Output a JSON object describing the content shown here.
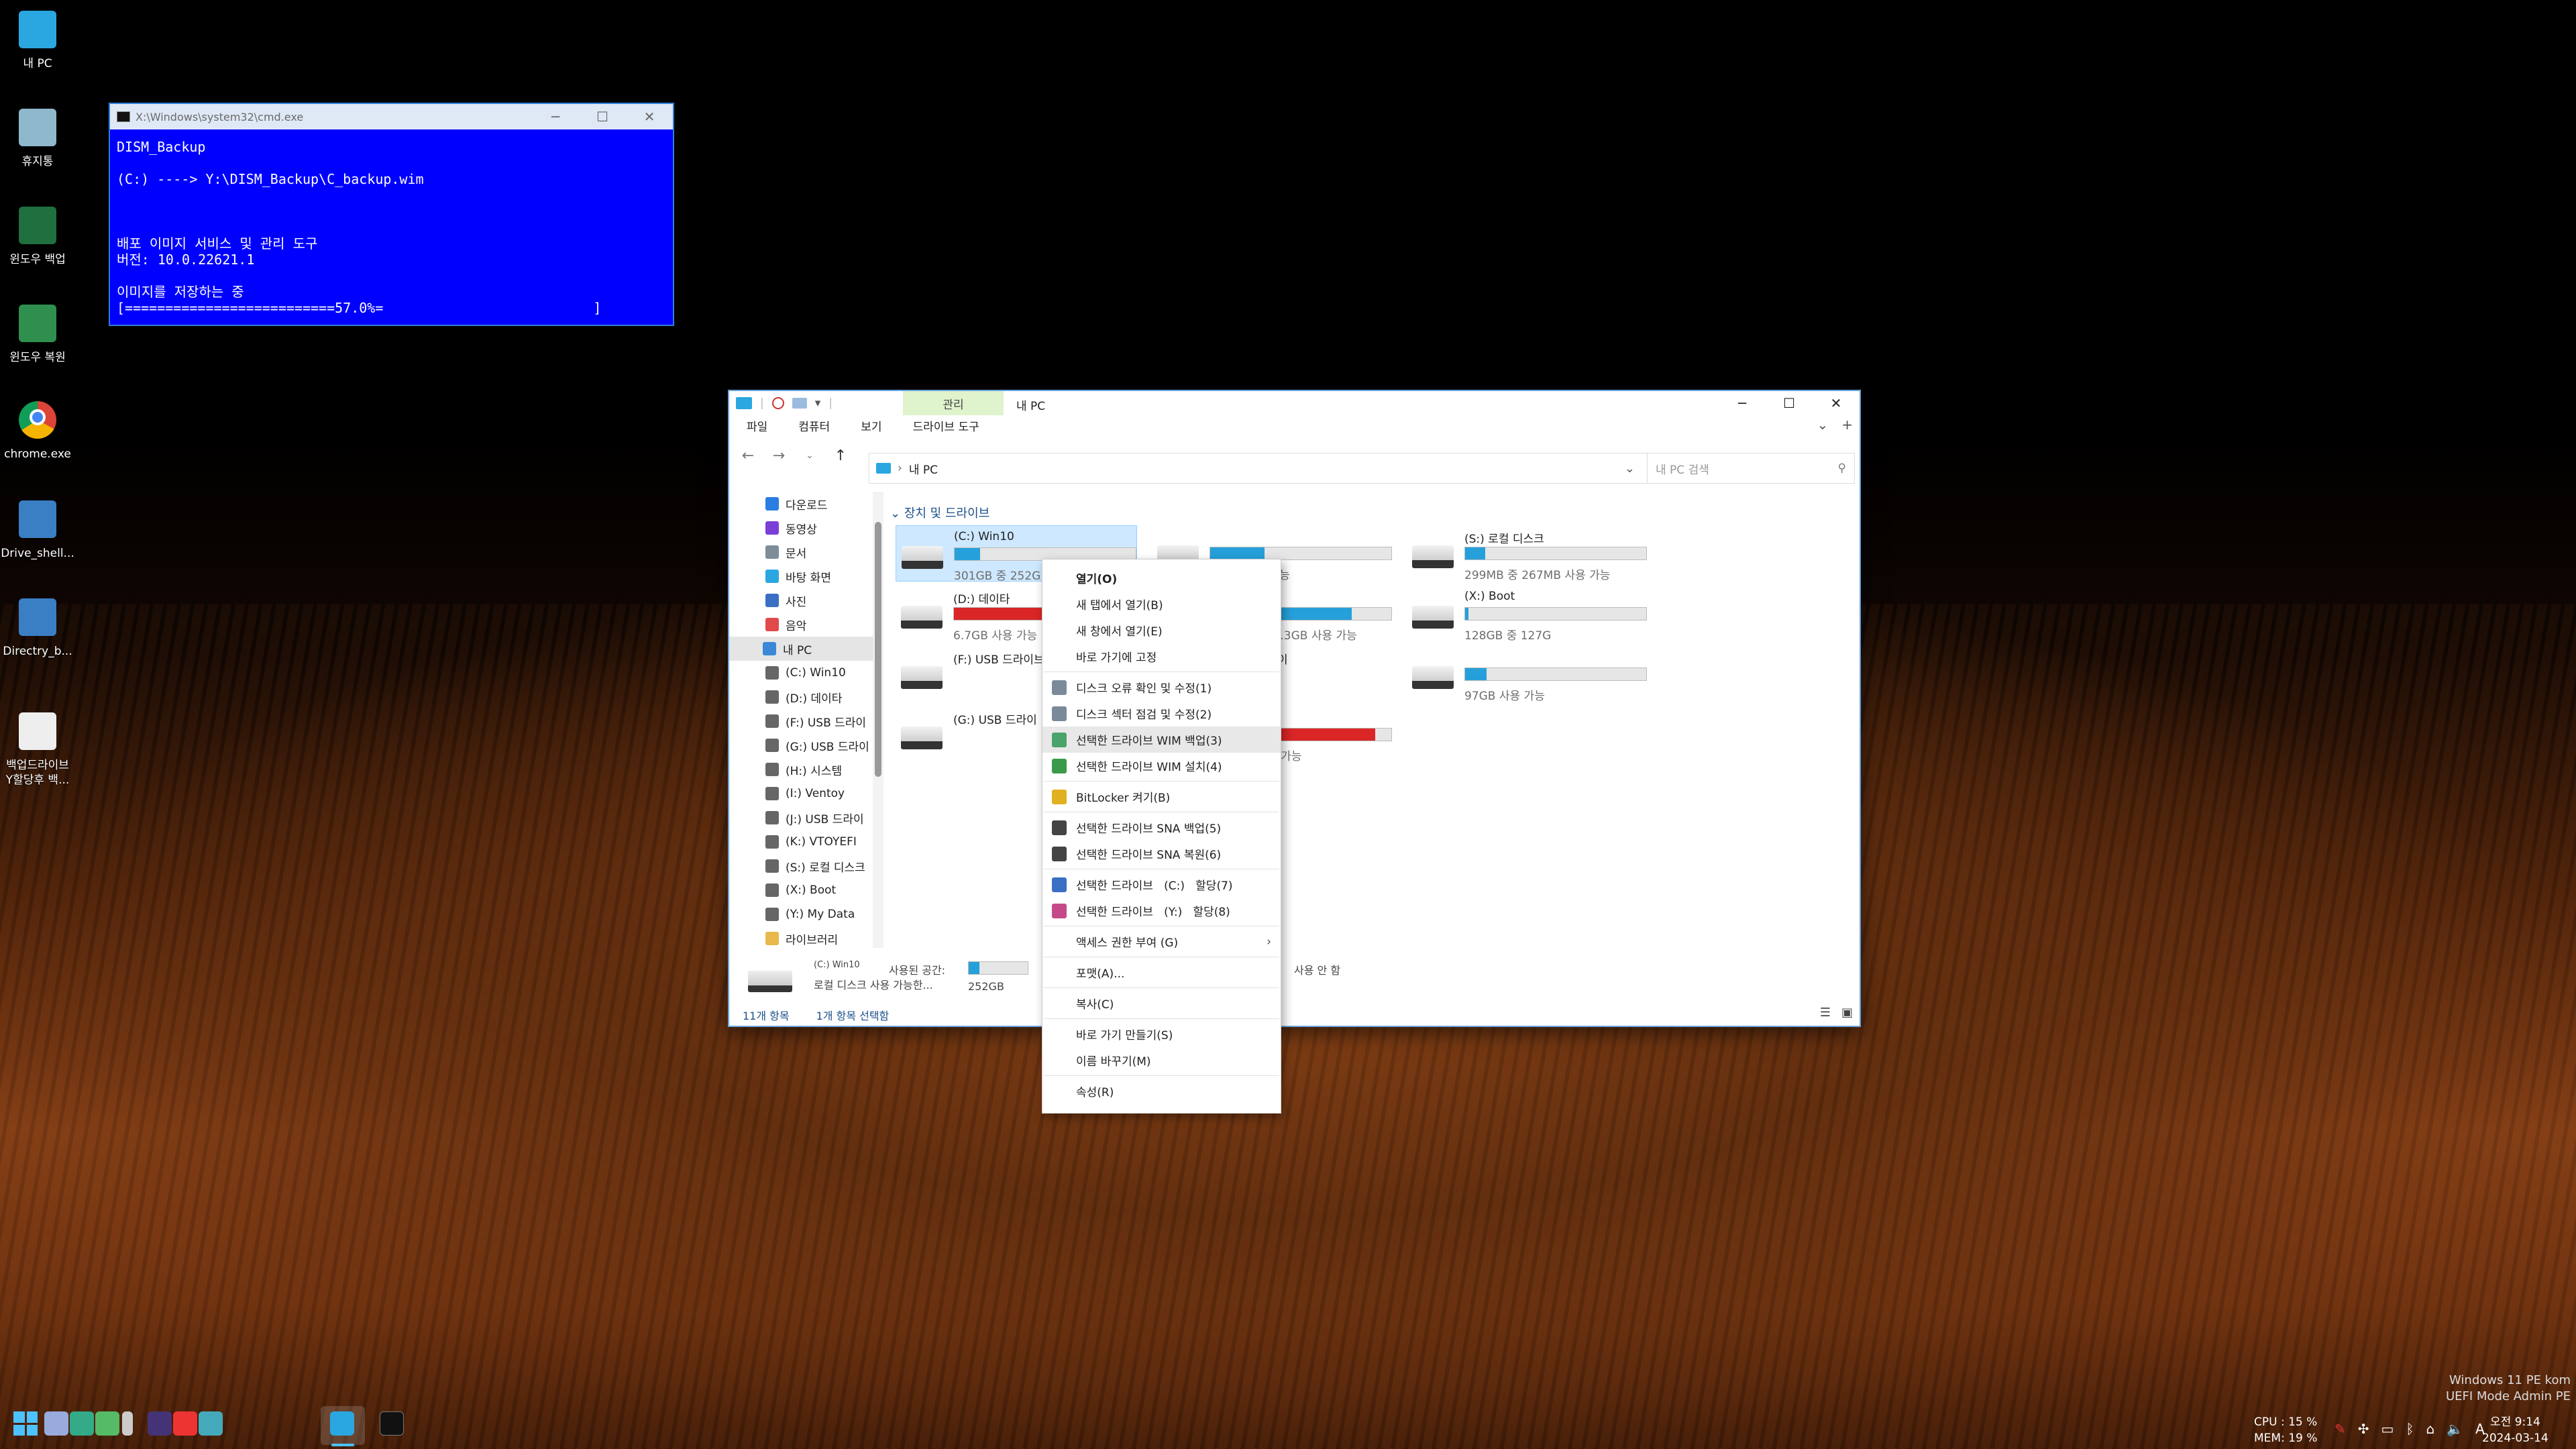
{
  "desktop_icons": [
    {
      "label": "내 PC",
      "icon": "monitor-icon"
    },
    {
      "label": "휴지통",
      "icon": "recycle-bin-icon"
    },
    {
      "label": "윈도우 백업",
      "icon": "windows-backup-icon"
    },
    {
      "label": "윈도우 복원",
      "icon": "windows-restore-icon"
    },
    {
      "label": "chrome.exe",
      "icon": "chrome-icon"
    },
    {
      "label": "Drive_shell...",
      "icon": "script-icon"
    },
    {
      "label": "Directry_b...",
      "icon": "script-icon"
    },
    {
      "label": "백업드라이브\nY할당후 백...",
      "icon": "backup-drive-icon"
    }
  ],
  "cmd": {
    "title": "X:\\Windows\\system32\\cmd.exe",
    "lines": [
      "DISM_Backup",
      "",
      "(C:) ----> Y:\\DISM_Backup\\C_backup.wim",
      "",
      "",
      "",
      "배포 이미지 서비스 및 관리 도구",
      "버전: 10.0.22621.1",
      "",
      "이미지를 저장하는 중",
      "[==========================57.0%=                          ]"
    ],
    "progress_percent": 57.0
  },
  "explorer": {
    "manage_tab": "관리",
    "title": "내 PC",
    "ribbon": [
      "파일",
      "컴퓨터",
      "보기",
      "드라이브 도구"
    ],
    "address": "내 PC",
    "search_placeholder": "내 PC 검색",
    "nav_items": [
      {
        "label": "다운로드",
        "color": "#2a7de1",
        "indent": 1
      },
      {
        "label": "동영상",
        "color": "#7a3fd8",
        "indent": 1
      },
      {
        "label": "문서",
        "color": "#7f8c9a",
        "indent": 1
      },
      {
        "label": "바탕 화면",
        "color": "#2aa7e1",
        "indent": 1
      },
      {
        "label": "사진",
        "color": "#3a6fc4",
        "indent": 1
      },
      {
        "label": "음악",
        "color": "#e14a4a",
        "indent": 1
      },
      {
        "label": "내 PC",
        "color": "#3a88d6",
        "indent": 0,
        "selected": true
      },
      {
        "label": "(C:) Win10",
        "color": "#666",
        "indent": 1
      },
      {
        "label": "(D:) 데이타",
        "color": "#666",
        "indent": 1
      },
      {
        "label": "(F:) USB 드라이",
        "color": "#666",
        "indent": 1
      },
      {
        "label": "(G:) USB 드라이",
        "color": "#666",
        "indent": 1
      },
      {
        "label": "(H:) 시스템",
        "color": "#666",
        "indent": 1
      },
      {
        "label": "(I:) Ventoy",
        "color": "#666",
        "indent": 1
      },
      {
        "label": "(J:) USB 드라이",
        "color": "#666",
        "indent": 1
      },
      {
        "label": "(K:) VTOYEFI",
        "color": "#666",
        "indent": 1
      },
      {
        "label": "(S:) 로컬 디스크",
        "color": "#666",
        "indent": 1
      },
      {
        "label": "(X:) Boot",
        "color": "#666",
        "indent": 1
      },
      {
        "label": "(Y:) My Data",
        "color": "#666",
        "indent": 1
      },
      {
        "label": "라이브러리",
        "color": "#e8b84a",
        "indent": 1
      }
    ],
    "group_header": "장치 및 드라이브",
    "drives": [
      {
        "name": "(C:) Win10",
        "used_fraction": 0.14,
        "red": false,
        "stats": "301GB 중 252GB 사용 가능",
        "selected": true,
        "has_bar": true
      },
      {
        "name": "(D:) 데이타",
        "used_fraction": 0.97,
        "red": true,
        "stats": "6.7GB 사용 가능",
        "selected": false,
        "has_bar": true
      },
      {
        "name": "(F:) USB 드라이브",
        "used_fraction": 0,
        "red": false,
        "stats": "",
        "selected": false,
        "has_bar": false
      },
      {
        "name": "(G:) USB 드라이",
        "used_fraction": 0,
        "red": false,
        "stats": "",
        "selected": false,
        "has_bar": false
      },
      {
        "name": "",
        "used_fraction": 0.3,
        "red": false,
        "stats": "01GB 사용 가능",
        "selected": false,
        "has_bar": true
      },
      {
        "name": "(I:) Ventoy",
        "used_fraction": 0.78,
        "red": false,
        "stats": "232GB 중 51.3GB 사용 가능",
        "selected": false,
        "has_bar": true
      },
      {
        "name": "(J:) USB 드라이",
        "used_fraction": 0,
        "red": false,
        "stats": "",
        "selected": false,
        "has_bar": false
      },
      {
        "name": "",
        "used_fraction": 0.91,
        "red": true,
        "stats": "2.40MB 사용 가능",
        "selected": false,
        "has_bar": true
      },
      {
        "name": "(S:) 로컬 디스크",
        "used_fraction": 0.11,
        "red": false,
        "stats": "299MB 중 267MB 사용 가능",
        "selected": false,
        "has_bar": true
      },
      {
        "name": "(X:) Boot",
        "used_fraction": 0.02,
        "red": false,
        "stats": "128GB 중 127G",
        "selected": false,
        "has_bar": true
      },
      {
        "name": "",
        "used_fraction": 0.12,
        "red": false,
        "stats": "97GB 사용 가능",
        "selected": false,
        "has_bar": true
      }
    ],
    "details": {
      "drive_name": "(C:) Win10",
      "drive_type": "로컬 디스크 사용 가능한...",
      "used_label": "사용된 공간:",
      "used_value": "252GB",
      "bitlocker": "사용 안 함"
    },
    "status": {
      "count": "11개 항목",
      "selected": "1개 항목 선택함"
    }
  },
  "context_menu": [
    {
      "label": "열기(O)",
      "bold": true,
      "icon": ""
    },
    {
      "label": "새 탭에서 열기(B)",
      "icon": ""
    },
    {
      "label": "새 창에서 열기(E)",
      "icon": ""
    },
    {
      "label": "바로 가기에 고정",
      "icon": ""
    },
    {
      "sep": true
    },
    {
      "label": "디스크 오류 확인 및 수정(1)",
      "icon": "disk-check-icon",
      "color": "#7a8a9a"
    },
    {
      "label": "디스크 섹터 점검 및 수정(2)",
      "icon": "disk-sector-icon",
      "color": "#7a8a9a"
    },
    {
      "label": "선택한 드라이브 WIM 백업(3)",
      "icon": "wim-backup-icon",
      "color": "#4aa36b",
      "highlight": true
    },
    {
      "label": "선택한 드라이브 WIM 설치(4)",
      "icon": "wim-install-icon",
      "color": "#3a9a4a"
    },
    {
      "sep": true
    },
    {
      "label": "BitLocker 켜기(B)",
      "icon": "bitlocker-icon",
      "color": "#e0b020"
    },
    {
      "sep": true
    },
    {
      "label": "선택한 드라이브 SNA 백업(5)",
      "icon": "sna-backup-icon",
      "color": "#444"
    },
    {
      "label": "선택한 드라이브 SNA 복원(6)",
      "icon": "sna-restore-icon",
      "color": "#444"
    },
    {
      "sep": true
    },
    {
      "label": "선택한 드라이브   (C:)   할당(7)",
      "icon": "assign-c-icon",
      "color": "#3a6fc4"
    },
    {
      "label": "선택한 드라이브   (Y:)   할당(8)",
      "icon": "assign-y-icon",
      "color": "#c44a8a"
    },
    {
      "sep": true
    },
    {
      "label": "액세스 권한 부여 (G)",
      "icon": "",
      "submenu": true
    },
    {
      "sep": true
    },
    {
      "label": "포맷(A)...",
      "icon": ""
    },
    {
      "sep": true
    },
    {
      "label": "복사(C)",
      "icon": ""
    },
    {
      "sep": true
    },
    {
      "label": "바로 가기 만들기(S)",
      "icon": ""
    },
    {
      "label": "이름 바꾸기(M)",
      "icon": ""
    },
    {
      "sep": true
    },
    {
      "label": "속성(R)",
      "icon": ""
    }
  ],
  "taskbar": {
    "cpu": "CPU : 15 %",
    "mem": "MEM: 19 %",
    "time": "오전 9:14",
    "date": "2024-03-14",
    "ime": "A",
    "watermark_line1": "Windows 11 PE kom",
    "watermark_line2": "UEFI Mode Admin PE"
  },
  "colors": {
    "accent": "#26a0da",
    "danger": "#da2626",
    "cmd_bg": "#0000ff"
  }
}
